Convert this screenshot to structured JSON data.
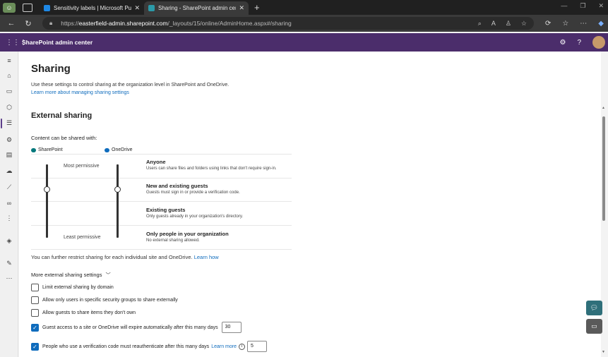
{
  "browser": {
    "tabs": [
      {
        "title": "Sensitivity labels | Microsoft Purview",
        "active": false
      },
      {
        "title": "Sharing - SharePoint admin center",
        "active": true
      }
    ],
    "url_prefix": "https://",
    "url_host": "easterfield-admin.sharepoint.com",
    "url_path": "/_layouts/15/online/AdminHome.aspx#/sharing"
  },
  "app": {
    "title": "SharePoint admin center"
  },
  "page": {
    "title": "Sharing",
    "intro": "Use these settings to control sharing at the organization level in SharePoint and OneDrive.",
    "intro_link": "Learn more about managing sharing settings",
    "section_title": "External sharing",
    "shared_with_label": "Content can be shared with:",
    "services": [
      {
        "name": "SharePoint",
        "color": "#03787c"
      },
      {
        "name": "OneDrive",
        "color": "#0f6cbd"
      }
    ],
    "most_permissive": "Most permissive",
    "least_permissive": "Least permissive",
    "levels": [
      {
        "name": "Anyone",
        "desc": "Users can share files and folders using links that don't require sign-in."
      },
      {
        "name": "New and existing guests",
        "desc": "Guests must sign in or provide a verification code."
      },
      {
        "name": "Existing guests",
        "desc": "Only guests already in your organization's directory."
      },
      {
        "name": "Only people in your organization",
        "desc": "No external sharing allowed."
      }
    ],
    "restrict_text": "You can further restrict sharing for each individual site and OneDrive.",
    "restrict_link": "Learn how",
    "more_settings": "More external sharing settings",
    "options": [
      {
        "label": "Limit external sharing by domain",
        "checked": false
      },
      {
        "label": "Allow only users in specific security groups to share externally",
        "checked": false
      },
      {
        "label": "Allow guests to share items they don't own",
        "checked": false
      },
      {
        "label": "Guest access to a site or OneDrive will expire automatically after this many days",
        "checked": true,
        "value": "30"
      },
      {
        "label": "People who use a verification code must reauthenticate after this many days",
        "checked": true,
        "link": "Learn more",
        "value": "5"
      }
    ]
  },
  "colors": {
    "accent": "#4b2d6b",
    "link": "#0f6cbd",
    "fab_teal": "#2f6f7a",
    "fab_gray": "#5a5a5a"
  }
}
